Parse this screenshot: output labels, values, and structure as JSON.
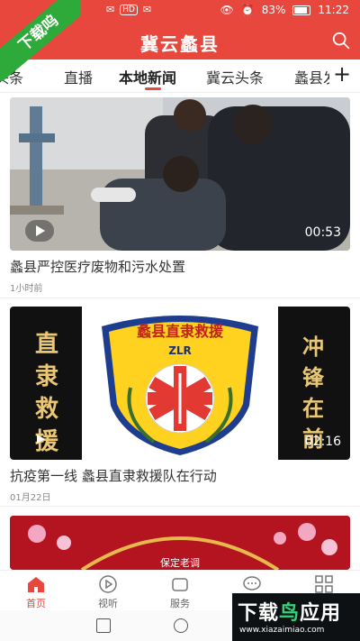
{
  "status_bar": {
    "time": "11:22",
    "battery": "83%",
    "hd_badge": "HD"
  },
  "header": {
    "title": "冀云蠡县"
  },
  "watermark": {
    "corner_text": "下载呜",
    "brand_name_a": "下载",
    "brand_name_b": "鸟",
    "brand_name_c": "应用",
    "brand_url": "www.xiazaimiao.com"
  },
  "tabs": [
    {
      "label": "头条"
    },
    {
      "label": "直播"
    },
    {
      "label": "本地新闻"
    },
    {
      "label": "冀云头条"
    },
    {
      "label": "蠡县发"
    }
  ],
  "tabs_add_label": "+",
  "feed": [
    {
      "title": "蠡县严控医疗废物和污水处置",
      "meta": "1小时前",
      "duration": "00:53"
    },
    {
      "title": "抗疫第一线 蠡县直隶救援队在行动",
      "meta": "01月22日",
      "duration": "02:16",
      "badge_title": "蠡县直隶救援",
      "badge_code": "ZLR",
      "left_slogan": "直隶救援",
      "right_slogan": "冲锋在前"
    },
    {
      "banner_text": "保定老调"
    }
  ],
  "bottom_nav": [
    {
      "label": "首页",
      "icon": "home-icon",
      "active": true
    },
    {
      "label": "视听",
      "icon": "play-circle-icon",
      "active": false
    },
    {
      "label": "服务",
      "icon": "service-icon",
      "active": false
    },
    {
      "label": "",
      "icon": "chat-icon",
      "active": false
    },
    {
      "label": "",
      "icon": "grid-icon",
      "active": false
    }
  ],
  "colors": {
    "accent": "#e8473e",
    "watermark_green": "#2eaa3a"
  }
}
